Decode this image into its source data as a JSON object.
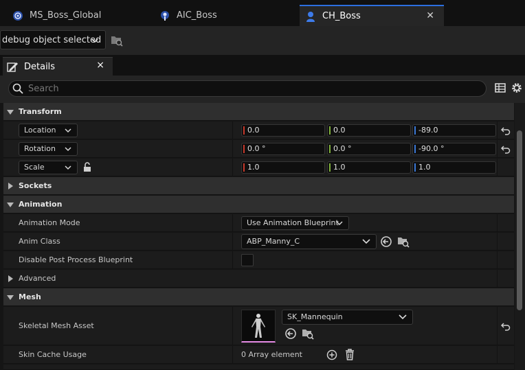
{
  "tabs": [
    {
      "label": "MS_Boss_Global",
      "icon": "state-tree-icon"
    },
    {
      "label": "AIC_Boss",
      "icon": "ai-controller-icon"
    },
    {
      "label": "CH_Boss",
      "icon": "character-icon",
      "active": true
    }
  ],
  "toolbar": {
    "debug_select": "debug object selected"
  },
  "panel": {
    "title": "Details",
    "close": "×"
  },
  "search": {
    "placeholder": "Search"
  },
  "transform": {
    "label": "Transform",
    "location": {
      "mode": "Location",
      "x": "0.0",
      "y": "0.0",
      "z": "-89.0"
    },
    "rotation": {
      "mode": "Rotation",
      "x": "0.0 °",
      "y": "0.0 °",
      "z": "-90.0 °"
    },
    "scale": {
      "mode": "Scale",
      "x": "1.0",
      "y": "1.0",
      "z": "1.0"
    }
  },
  "sockets": {
    "label": "Sockets"
  },
  "animation": {
    "label": "Animation",
    "mode_label": "Animation Mode",
    "mode_value": "Use Animation Blueprint",
    "class_label": "Anim Class",
    "class_value": "ABP_Manny_C",
    "disable_pp_label": "Disable Post Process Blueprint"
  },
  "advanced": {
    "label": "Advanced"
  },
  "mesh": {
    "label": "Mesh",
    "asset_label": "Skeletal Mesh Asset",
    "asset_value": "SK_Mannequin",
    "skin_cache_label": "Skin Cache Usage",
    "skin_cache_value": "0 Array element"
  },
  "colors": {
    "x_axis": "#c8392b",
    "y_axis": "#7fb03a",
    "z_axis": "#3a78d6",
    "accent": "#2c6fe0"
  }
}
